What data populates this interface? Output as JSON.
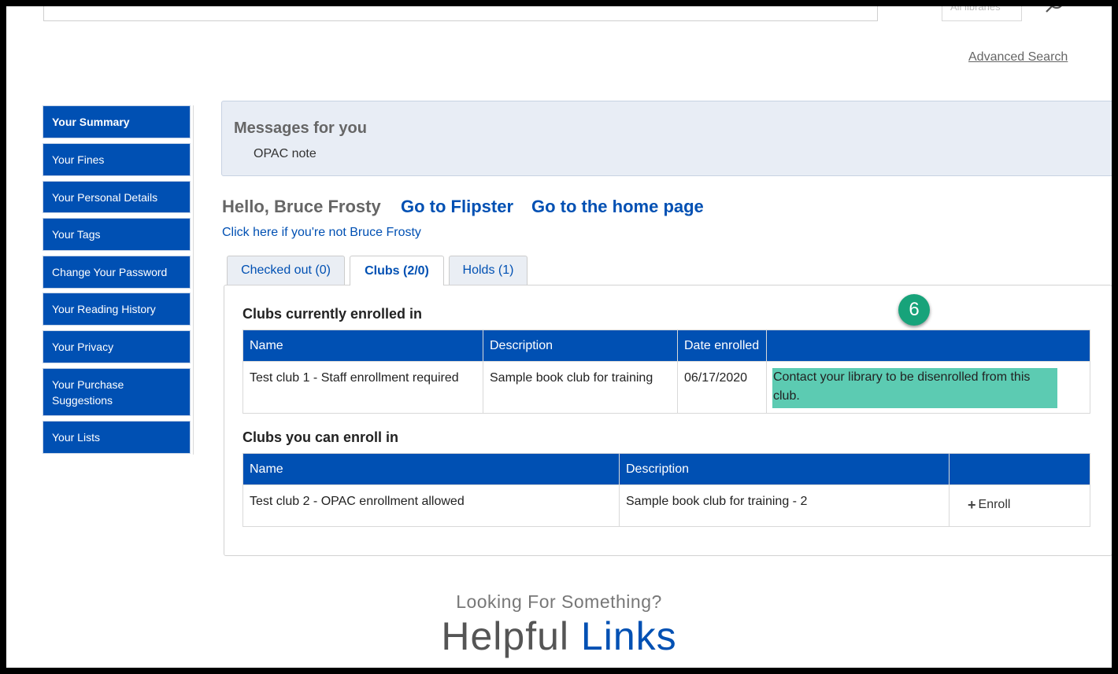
{
  "search": {
    "branch_text": "All libraries",
    "advanced_search": "Advanced Search"
  },
  "sidebar": {
    "items": [
      {
        "label": "Your Summary"
      },
      {
        "label": "Your Fines"
      },
      {
        "label": "Your Personal Details"
      },
      {
        "label": "Your Tags"
      },
      {
        "label": "Change Your Password"
      },
      {
        "label": "Your Reading History"
      },
      {
        "label": "Your Privacy"
      },
      {
        "label": "Your Purchase Suggestions"
      },
      {
        "label": "Your Lists"
      }
    ]
  },
  "messages": {
    "title": "Messages for you",
    "note": "OPAC note"
  },
  "greeting": {
    "hello": "Hello, Bruce Frosty",
    "flipster": "Go to Flipster",
    "home": "Go to the home page",
    "not_you": "Click here if you're not Bruce Frosty"
  },
  "tabs": [
    {
      "label": "Checked out (0)"
    },
    {
      "label": "Clubs (2/0)"
    },
    {
      "label": "Holds (1)"
    }
  ],
  "enrolled": {
    "heading": "Clubs currently enrolled in",
    "columns": [
      "Name",
      "Description",
      "Date enrolled",
      ""
    ],
    "rows": [
      {
        "name": "Test club 1 - Staff enrollment required",
        "description": "Sample book club for training",
        "date": "06/17/2020",
        "action": "Contact your library to be disenrolled from this club."
      }
    ]
  },
  "available": {
    "heading": "Clubs you can enroll in",
    "columns": [
      "Name",
      "Description",
      ""
    ],
    "rows": [
      {
        "name": "Test club 2 - OPAC enrollment allowed",
        "description": "Sample book club for training - 2",
        "action": "Enroll"
      }
    ]
  },
  "callout": "6",
  "footer": {
    "looking": "Looking For Something?",
    "helpful_1": "Helpful",
    "helpful_2": "Links"
  },
  "colors": {
    "brand_blue": "#0050b3",
    "highlight": "#5ccbb2",
    "callout": "#17a37a"
  },
  "icons": [
    "search-icon",
    "plus-icon"
  ]
}
